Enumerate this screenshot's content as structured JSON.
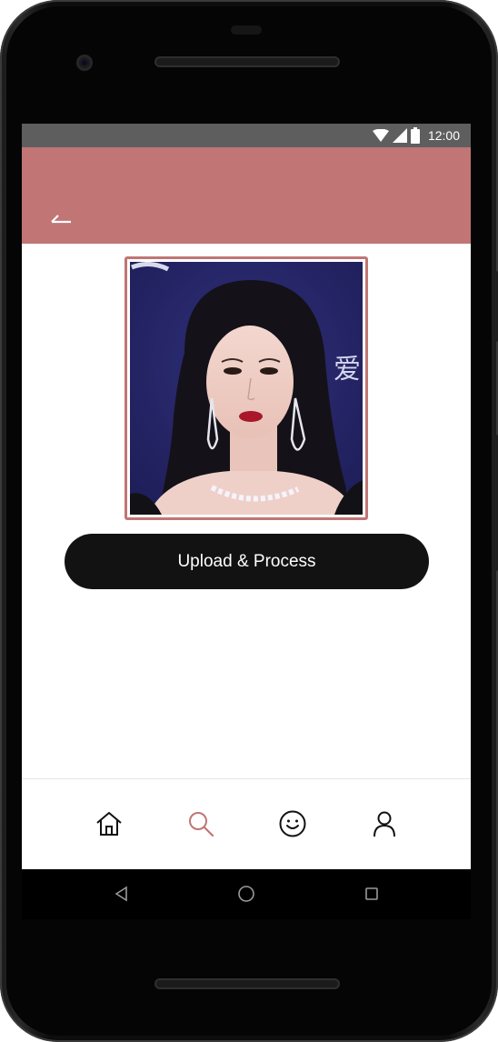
{
  "status_bar": {
    "time": "12:00",
    "icons": [
      "wifi-icon",
      "signal-icon",
      "battery-icon"
    ]
  },
  "app_bar": {
    "back_icon": "back-arrow-icon",
    "color": "#c17575"
  },
  "main": {
    "photo_alt": "Uploaded portrait photo",
    "upload_button_label": "Upload & Process"
  },
  "bottom_nav": {
    "items": [
      {
        "icon": "home-icon",
        "active": false
      },
      {
        "icon": "search-icon",
        "active": true
      },
      {
        "icon": "smiley-icon",
        "active": false
      },
      {
        "icon": "profile-icon",
        "active": false
      }
    ],
    "active_color": "#c17575",
    "inactive_color": "#111111"
  },
  "system_nav": {
    "icons": [
      "back-triangle-icon",
      "home-circle-icon",
      "recents-square-icon"
    ]
  }
}
